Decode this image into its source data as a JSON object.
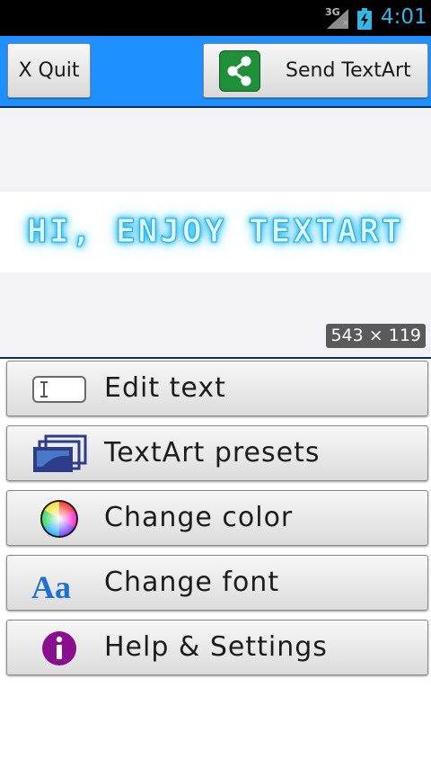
{
  "status_bar": {
    "network": "3G",
    "time": "4:01"
  },
  "toolbar": {
    "quit_label": "X Quit",
    "send_label": "Send TextArt"
  },
  "preview": {
    "art_text": "HI, ENJOY TEXTART",
    "dimensions": "543 × 119"
  },
  "menu": {
    "items": [
      {
        "label": "Edit text",
        "icon": "text-field-icon"
      },
      {
        "label": "TextArt presets",
        "icon": "stacked-layers-icon"
      },
      {
        "label": "Change color",
        "icon": "color-wheel-icon"
      },
      {
        "label": "Change font",
        "icon": "font-aa-icon"
      },
      {
        "label": "Help & Settings",
        "icon": "info-icon"
      }
    ]
  },
  "colors": {
    "toolbar_bg": "#1e90ff",
    "status_time": "#33b5e5",
    "share_green": "#1f8f3a",
    "info_purple": "#8a0f8e",
    "art_glow": "#2ec4f0"
  }
}
